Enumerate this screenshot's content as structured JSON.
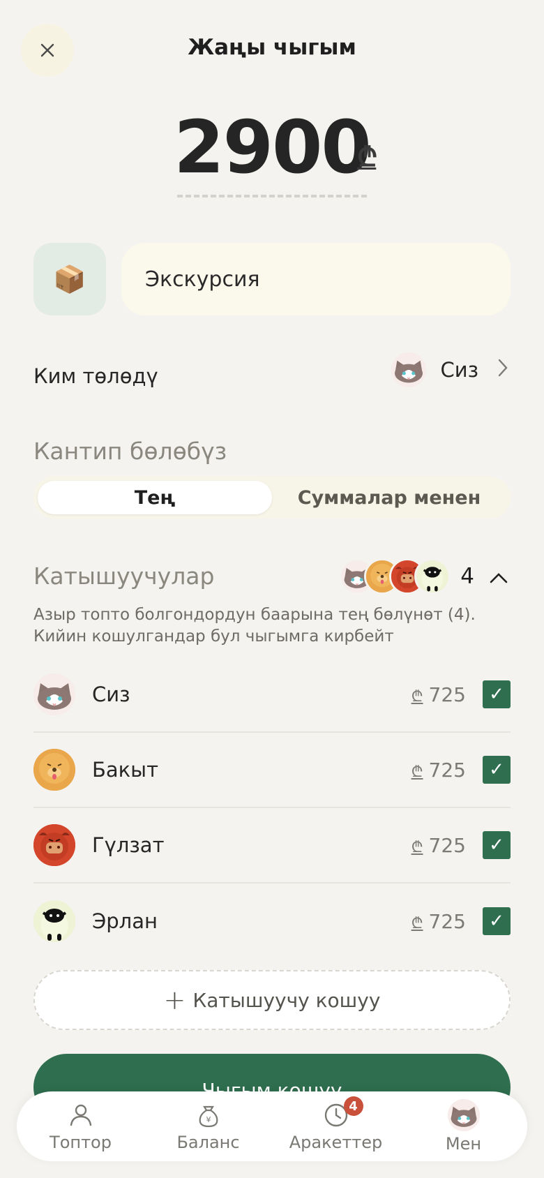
{
  "header": {
    "title": "Жаңы чыгым",
    "close_icon": "close-icon"
  },
  "amount": {
    "value": "2900",
    "currency": "₾"
  },
  "expense": {
    "category_icon": "package-icon",
    "category_emoji": "📦",
    "description": "Экскурсия"
  },
  "payer": {
    "label": "Ким төлөдү",
    "name": "Сиз",
    "avatar": "cat-avatar"
  },
  "split": {
    "title": "Кантип бөлөбүз",
    "options": [
      "Тең",
      "Суммалар менен"
    ],
    "selected": "Тең"
  },
  "participants": {
    "title": "Катышуучулар",
    "count": "4",
    "note": "Азыр топто болгондордун баарына тең бөлүнөт (4). Кийин кошулгандар бул чыгымга кирбейт",
    "items": [
      {
        "name": "Сиз",
        "currency": "₾",
        "amount": "725",
        "checked": true,
        "avatar": "cat"
      },
      {
        "name": "Бакыт",
        "currency": "₾",
        "amount": "725",
        "checked": true,
        "avatar": "dog"
      },
      {
        "name": "Гүлзат",
        "currency": "₾",
        "amount": "725",
        "checked": true,
        "avatar": "bull"
      },
      {
        "name": "Эрлан",
        "currency": "₾",
        "amount": "725",
        "checked": true,
        "avatar": "sheep"
      }
    ],
    "add_label": "Катышуучу кошуу"
  },
  "submit_label": "Чыгым кошуу",
  "nav": {
    "items": [
      {
        "label": "Топтор",
        "icon": "people-icon"
      },
      {
        "label": "Баланс",
        "icon": "money-bag-icon"
      },
      {
        "label": "Аракеттер",
        "icon": "clock-icon",
        "badge": "4"
      },
      {
        "label": "Мен",
        "icon": "cat-avatar"
      }
    ]
  },
  "colors": {
    "accent": "#2f6e4f",
    "background": "#f4f3ef",
    "badge": "#c9503b"
  }
}
